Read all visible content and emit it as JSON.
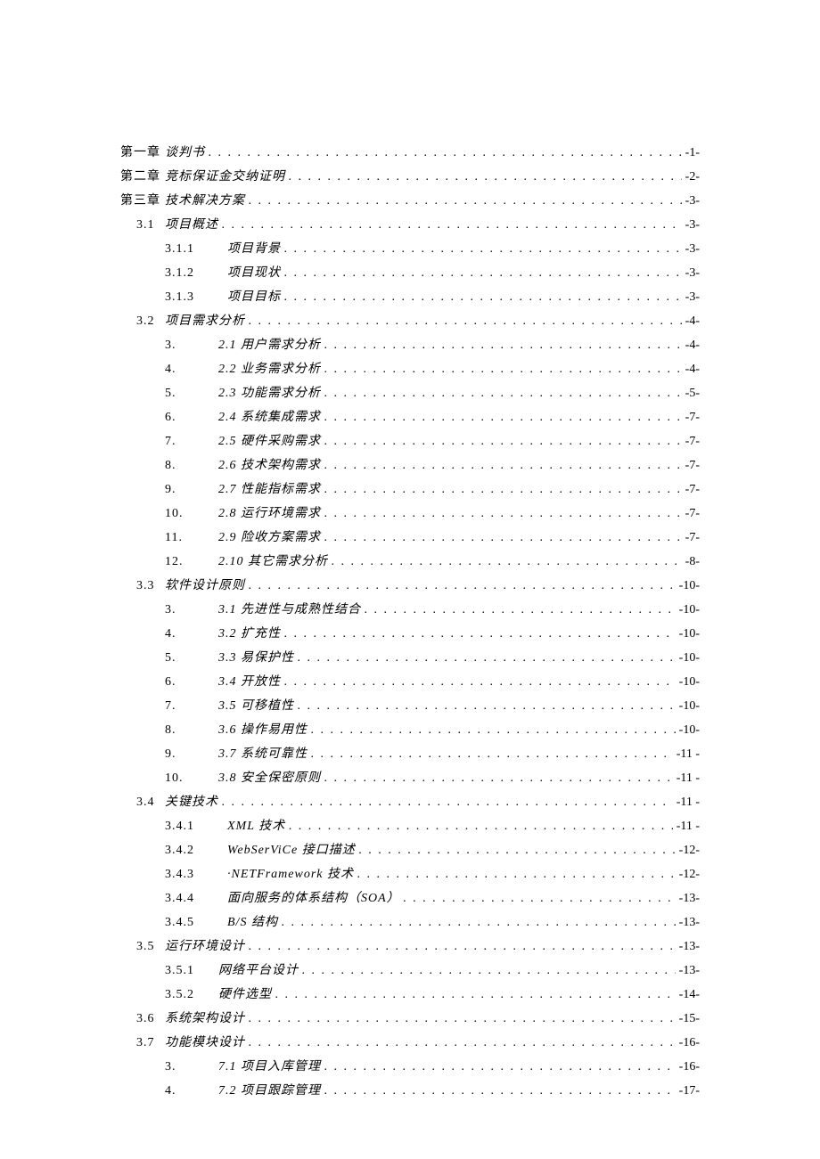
{
  "toc": [
    {
      "num": "第一章",
      "title": "谈判书",
      "page": "-1-",
      "level": 1,
      "subnum": "",
      "italic": true
    },
    {
      "num": "第二章",
      "title": "竞标保证金交纳证明",
      "page": "-2-",
      "level": 1,
      "subnum": "",
      "italic": true
    },
    {
      "num": "第三章",
      "title": "技术解决方案",
      "page": "-3-",
      "level": 1,
      "subnum": "",
      "italic": true
    },
    {
      "num": "3.1",
      "title": "项目概述",
      "page": "-3-",
      "level": 1,
      "subnum": "",
      "indent": true,
      "italic": true
    },
    {
      "num": "",
      "subnum": "3.1.1",
      "title": "项目背景",
      "page": "-3-",
      "level": 2,
      "italic": true,
      "wide": true
    },
    {
      "num": "",
      "subnum": "3.1.2",
      "title": "项目现状",
      "page": "-3-",
      "level": 2,
      "italic": true,
      "wide": true
    },
    {
      "num": "",
      "subnum": "3.1.3",
      "title": "项目目标",
      "page": "-3-",
      "level": 2,
      "italic": true,
      "wide": true
    },
    {
      "num": "3.2",
      "title": "项目需求分析",
      "page": "-4-",
      "level": 1,
      "subnum": "",
      "indent": true,
      "italic": true
    },
    {
      "num": "",
      "subnum": "3.",
      "title": "2.1 用户需求分析",
      "page": "-4-",
      "level": 2,
      "italic": true
    },
    {
      "num": "",
      "subnum": "4.",
      "title": "2.2 业务需求分析",
      "page": "-4-",
      "level": 2,
      "italic": true
    },
    {
      "num": "",
      "subnum": "5.",
      "title": "2.3 功能需求分析",
      "page": "-5-",
      "level": 2,
      "italic": true
    },
    {
      "num": "",
      "subnum": "6.",
      "title": "2.4 系统集成需求",
      "page": "-7-",
      "level": 2,
      "italic": true
    },
    {
      "num": "",
      "subnum": "7.",
      "title": "2.5 硬件采购需求",
      "page": "-7-",
      "level": 2,
      "italic": true
    },
    {
      "num": "",
      "subnum": "8.",
      "title": "2.6 技术架构需求",
      "page": "-7-",
      "level": 2,
      "italic": true
    },
    {
      "num": "",
      "subnum": "9.",
      "title": "2.7 性能指标需求",
      "page": "-7-",
      "level": 2,
      "italic": true
    },
    {
      "num": "",
      "subnum": "10.",
      "title": "2.8 运行环境需求",
      "page": "-7-",
      "level": 2,
      "italic": true
    },
    {
      "num": "",
      "subnum": "11.",
      "title": "2.9 险收方案需求",
      "page": "-7-",
      "level": 2,
      "italic": true
    },
    {
      "num": "",
      "subnum": "12.",
      "title": "2.10 其它需求分析",
      "page": "-8-",
      "level": 2,
      "italic": true
    },
    {
      "num": "3.3",
      "title": "软件设计原则",
      "page": "-10-",
      "level": 1,
      "subnum": "",
      "indent": true,
      "italic": true
    },
    {
      "num": "",
      "subnum": "3.",
      "title": "3.1 先进性与成熟性结合",
      "page": "-10-",
      "level": 2,
      "italic": true
    },
    {
      "num": "",
      "subnum": "4.",
      "title": "3.2 扩充性",
      "page": "-10-",
      "level": 2,
      "italic": true
    },
    {
      "num": "",
      "subnum": "5.",
      "title": "3.3 易保护性",
      "page": "-10-",
      "level": 2,
      "italic": true
    },
    {
      "num": "",
      "subnum": "6.",
      "title": "3.4 开放性",
      "page": "-10-",
      "level": 2,
      "italic": true
    },
    {
      "num": "",
      "subnum": "7.",
      "title": "3.5 可移植性",
      "page": "-10-",
      "level": 2,
      "italic": true
    },
    {
      "num": "",
      "subnum": "8.",
      "title": "3.6 操作易用性",
      "page": "-10-",
      "level": 2,
      "italic": true
    },
    {
      "num": "",
      "subnum": "9.",
      "title": "3.7 系统可靠性",
      "page": "-11   -",
      "level": 2,
      "italic": true
    },
    {
      "num": "",
      "subnum": "10.",
      "title": "3.8 安全保密原则",
      "page": "-11   -",
      "level": 2,
      "italic": true
    },
    {
      "num": "3.4",
      "title": " 关键技术",
      "page": "-11   -",
      "level": 1,
      "subnum": "",
      "indent": true,
      "italic": true
    },
    {
      "num": "",
      "subnum": "3.4.1",
      "title": "XML 技术",
      "page": "-11   -",
      "level": 2,
      "italic": true,
      "wide": true
    },
    {
      "num": "",
      "subnum": "3.4.2",
      "title": "WebSerViCe 接口描述",
      "page": "-12-",
      "level": 2,
      "italic": true,
      "wide": true
    },
    {
      "num": "",
      "subnum": "3.4.3",
      "title": "·NETFramework 技术",
      "page": "-12-",
      "level": 2,
      "italic": true,
      "wide": true
    },
    {
      "num": "",
      "subnum": "3.4.4",
      "title": "面向服务的体系结构（SOA）",
      "page": "-13-",
      "level": 2,
      "italic": true,
      "wide": true
    },
    {
      "num": "",
      "subnum": "3.4.5",
      "title": "B/S 结构",
      "page": "-13-",
      "level": 2,
      "italic": true,
      "wide": true
    },
    {
      "num": "3.5",
      "title": "运行环境设计",
      "page": "-13-",
      "level": 1,
      "subnum": "",
      "indent": true,
      "italic": true
    },
    {
      "num": "",
      "subnum": "3.5.1",
      "title": "网络平台设计",
      "page": "-13-",
      "level": 2,
      "italic": true,
      "wide": false
    },
    {
      "num": "",
      "subnum": "3.5.2",
      "title": "硬件选型",
      "page": "-14-",
      "level": 2,
      "italic": true,
      "wide": false
    },
    {
      "num": "3.6",
      "title": "系统架构设计",
      "page": "-15-",
      "level": 1,
      "subnum": "",
      "indent": true,
      "italic": true
    },
    {
      "num": "3.7",
      "title": "功能模块设计",
      "page": "-16-",
      "level": 1,
      "subnum": "",
      "indent": true,
      "italic": true
    },
    {
      "num": "",
      "subnum": "3.",
      "title": "7.1 项目入库管理",
      "page": "-16-",
      "level": 2,
      "italic": true
    },
    {
      "num": "",
      "subnum": "4.",
      "title": "7.2 项目跟踪管理",
      "page": "-17-",
      "level": 2,
      "italic": true
    }
  ]
}
